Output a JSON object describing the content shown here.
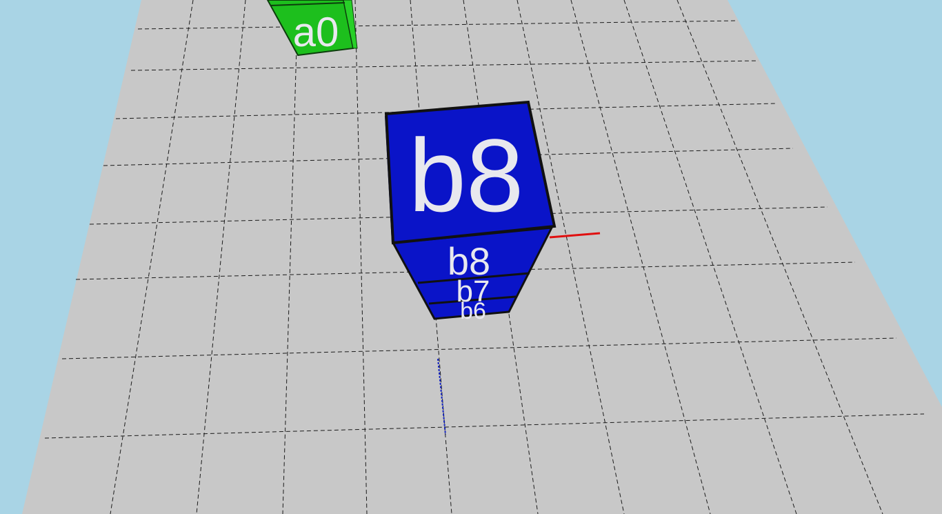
{
  "scene": {
    "sky_color": "#a9d4e5",
    "floor_color": "#c8c8c8",
    "grid_line_color": "#1a1a1a",
    "axis_x_color": "#e01010",
    "axis_z_color": "#1020c0"
  },
  "cubes": {
    "green": {
      "color": "#1dbf1d",
      "label": "a0"
    },
    "blue_stack": {
      "color": "#0a14c8",
      "top_label": "b8",
      "side_labels": [
        "b8",
        "b7",
        "b6"
      ]
    }
  }
}
